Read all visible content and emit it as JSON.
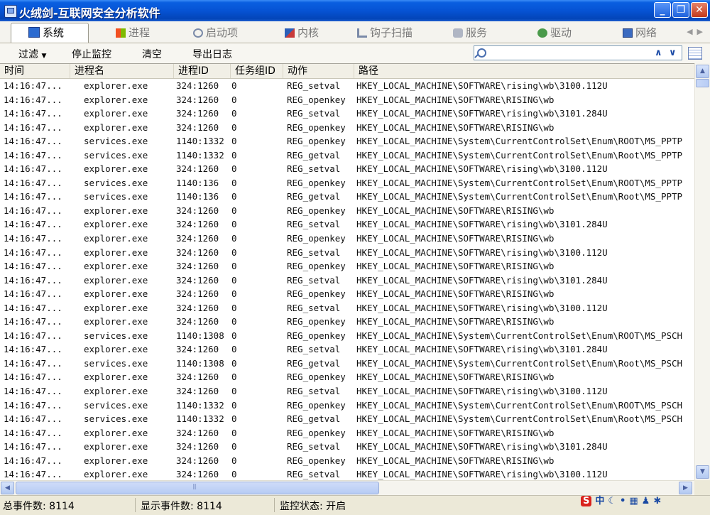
{
  "window": {
    "title": "火绒剑-互联网安全分析软件"
  },
  "tabs": [
    {
      "label": "系统",
      "icon": "system-icon",
      "active": true
    },
    {
      "label": "进程",
      "icon": "windows-flag-icon",
      "active": false
    },
    {
      "label": "启动项",
      "icon": "gear-icon",
      "active": false
    },
    {
      "label": "内核",
      "icon": "kernel-icon",
      "active": false
    },
    {
      "label": "钩子扫描",
      "icon": "hook-icon",
      "active": false
    },
    {
      "label": "服务",
      "icon": "service-icon",
      "active": false
    },
    {
      "label": "驱动",
      "icon": "driver-icon",
      "active": false
    },
    {
      "label": "网络",
      "icon": "network-icon",
      "active": false
    }
  ],
  "toolbar": {
    "filter": "过滤",
    "stop": "停止监控",
    "clear": "清空",
    "export": "导出日志",
    "search_value": ""
  },
  "columns": [
    "时间",
    "进程名",
    "进程ID",
    "任务组ID",
    "动作",
    "路径"
  ],
  "rows": [
    {
      "time": "14:16:47...",
      "icon": "explorer-icon",
      "name": "explorer.exe",
      "pid": "324:1260",
      "tg": "0",
      "action": "REG_setval",
      "path": "HKEY_LOCAL_MACHINE\\SOFTWARE\\rising\\wb\\3100.112U"
    },
    {
      "time": "14:16:47...",
      "icon": "explorer-icon",
      "name": "explorer.exe",
      "pid": "324:1260",
      "tg": "0",
      "action": "REG_openkey",
      "path": "HKEY_LOCAL_MACHINE\\SOFTWARE\\RISING\\wb"
    },
    {
      "time": "14:16:47...",
      "icon": "explorer-icon",
      "name": "explorer.exe",
      "pid": "324:1260",
      "tg": "0",
      "action": "REG_setval",
      "path": "HKEY_LOCAL_MACHINE\\SOFTWARE\\rising\\wb\\3101.284U"
    },
    {
      "time": "14:16:47...",
      "icon": "explorer-icon",
      "name": "explorer.exe",
      "pid": "324:1260",
      "tg": "0",
      "action": "REG_openkey",
      "path": "HKEY_LOCAL_MACHINE\\SOFTWARE\\RISING\\wb"
    },
    {
      "time": "14:16:47...",
      "icon": "services-icon",
      "name": "services.exe",
      "pid": "1140:1332",
      "tg": "0",
      "action": "REG_openkey",
      "path": "HKEY_LOCAL_MACHINE\\System\\CurrentControlSet\\Enum\\ROOT\\MS_PPTP"
    },
    {
      "time": "14:16:47...",
      "icon": "services-icon",
      "name": "services.exe",
      "pid": "1140:1332",
      "tg": "0",
      "action": "REG_getval",
      "path": "HKEY_LOCAL_MACHINE\\System\\CurrentControlSet\\Enum\\Root\\MS_PPTP"
    },
    {
      "time": "14:16:47...",
      "icon": "explorer-icon",
      "name": "explorer.exe",
      "pid": "324:1260",
      "tg": "0",
      "action": "REG_setval",
      "path": "HKEY_LOCAL_MACHINE\\SOFTWARE\\rising\\wb\\3100.112U"
    },
    {
      "time": "14:16:47...",
      "icon": "services-icon",
      "name": "services.exe",
      "pid": "1140:136",
      "tg": "0",
      "action": "REG_openkey",
      "path": "HKEY_LOCAL_MACHINE\\System\\CurrentControlSet\\Enum\\ROOT\\MS_PPTP"
    },
    {
      "time": "14:16:47...",
      "icon": "services-icon",
      "name": "services.exe",
      "pid": "1140:136",
      "tg": "0",
      "action": "REG_getval",
      "path": "HKEY_LOCAL_MACHINE\\System\\CurrentControlSet\\Enum\\Root\\MS_PPTP"
    },
    {
      "time": "14:16:47...",
      "icon": "explorer-icon",
      "name": "explorer.exe",
      "pid": "324:1260",
      "tg": "0",
      "action": "REG_openkey",
      "path": "HKEY_LOCAL_MACHINE\\SOFTWARE\\RISING\\wb"
    },
    {
      "time": "14:16:47...",
      "icon": "explorer-icon",
      "name": "explorer.exe",
      "pid": "324:1260",
      "tg": "0",
      "action": "REG_setval",
      "path": "HKEY_LOCAL_MACHINE\\SOFTWARE\\rising\\wb\\3101.284U"
    },
    {
      "time": "14:16:47...",
      "icon": "explorer-icon",
      "name": "explorer.exe",
      "pid": "324:1260",
      "tg": "0",
      "action": "REG_openkey",
      "path": "HKEY_LOCAL_MACHINE\\SOFTWARE\\RISING\\wb"
    },
    {
      "time": "14:16:47...",
      "icon": "explorer-icon",
      "name": "explorer.exe",
      "pid": "324:1260",
      "tg": "0",
      "action": "REG_setval",
      "path": "HKEY_LOCAL_MACHINE\\SOFTWARE\\rising\\wb\\3100.112U"
    },
    {
      "time": "14:16:47...",
      "icon": "explorer-icon",
      "name": "explorer.exe",
      "pid": "324:1260",
      "tg": "0",
      "action": "REG_openkey",
      "path": "HKEY_LOCAL_MACHINE\\SOFTWARE\\RISING\\wb"
    },
    {
      "time": "14:16:47...",
      "icon": "explorer-icon",
      "name": "explorer.exe",
      "pid": "324:1260",
      "tg": "0",
      "action": "REG_setval",
      "path": "HKEY_LOCAL_MACHINE\\SOFTWARE\\rising\\wb\\3101.284U"
    },
    {
      "time": "14:16:47...",
      "icon": "explorer-icon",
      "name": "explorer.exe",
      "pid": "324:1260",
      "tg": "0",
      "action": "REG_openkey",
      "path": "HKEY_LOCAL_MACHINE\\SOFTWARE\\RISING\\wb"
    },
    {
      "time": "14:16:47...",
      "icon": "explorer-icon",
      "name": "explorer.exe",
      "pid": "324:1260",
      "tg": "0",
      "action": "REG_setval",
      "path": "HKEY_LOCAL_MACHINE\\SOFTWARE\\rising\\wb\\3100.112U"
    },
    {
      "time": "14:16:47...",
      "icon": "explorer-icon",
      "name": "explorer.exe",
      "pid": "324:1260",
      "tg": "0",
      "action": "REG_openkey",
      "path": "HKEY_LOCAL_MACHINE\\SOFTWARE\\RISING\\wb"
    },
    {
      "time": "14:16:47...",
      "icon": "services-icon",
      "name": "services.exe",
      "pid": "1140:1308",
      "tg": "0",
      "action": "REG_openkey",
      "path": "HKEY_LOCAL_MACHINE\\System\\CurrentControlSet\\Enum\\ROOT\\MS_PSCH"
    },
    {
      "time": "14:16:47...",
      "icon": "explorer-icon",
      "name": "explorer.exe",
      "pid": "324:1260",
      "tg": "0",
      "action": "REG_setval",
      "path": "HKEY_LOCAL_MACHINE\\SOFTWARE\\rising\\wb\\3101.284U"
    },
    {
      "time": "14:16:47...",
      "icon": "services-icon",
      "name": "services.exe",
      "pid": "1140:1308",
      "tg": "0",
      "action": "REG_getval",
      "path": "HKEY_LOCAL_MACHINE\\System\\CurrentControlSet\\Enum\\Root\\MS_PSCH"
    },
    {
      "time": "14:16:47...",
      "icon": "explorer-icon",
      "name": "explorer.exe",
      "pid": "324:1260",
      "tg": "0",
      "action": "REG_openkey",
      "path": "HKEY_LOCAL_MACHINE\\SOFTWARE\\RISING\\wb"
    },
    {
      "time": "14:16:47...",
      "icon": "explorer-icon",
      "name": "explorer.exe",
      "pid": "324:1260",
      "tg": "0",
      "action": "REG_setval",
      "path": "HKEY_LOCAL_MACHINE\\SOFTWARE\\rising\\wb\\3100.112U"
    },
    {
      "time": "14:16:47...",
      "icon": "services-icon",
      "name": "services.exe",
      "pid": "1140:1332",
      "tg": "0",
      "action": "REG_openkey",
      "path": "HKEY_LOCAL_MACHINE\\System\\CurrentControlSet\\Enum\\ROOT\\MS_PSCH"
    },
    {
      "time": "14:16:47...",
      "icon": "services-icon",
      "name": "services.exe",
      "pid": "1140:1332",
      "tg": "0",
      "action": "REG_getval",
      "path": "HKEY_LOCAL_MACHINE\\System\\CurrentControlSet\\Enum\\Root\\MS_PSCH"
    },
    {
      "time": "14:16:47...",
      "icon": "explorer-icon",
      "name": "explorer.exe",
      "pid": "324:1260",
      "tg": "0",
      "action": "REG_openkey",
      "path": "HKEY_LOCAL_MACHINE\\SOFTWARE\\RISING\\wb"
    },
    {
      "time": "14:16:47...",
      "icon": "explorer-icon",
      "name": "explorer.exe",
      "pid": "324:1260",
      "tg": "0",
      "action": "REG_setval",
      "path": "HKEY_LOCAL_MACHINE\\SOFTWARE\\rising\\wb\\3101.284U"
    },
    {
      "time": "14:16:47...",
      "icon": "explorer-icon",
      "name": "explorer.exe",
      "pid": "324:1260",
      "tg": "0",
      "action": "REG_openkey",
      "path": "HKEY_LOCAL_MACHINE\\SOFTWARE\\RISING\\wb"
    },
    {
      "time": "14:16:47...",
      "icon": "explorer-icon",
      "name": "explorer.exe",
      "pid": "324:1260",
      "tg": "0",
      "action": "REG_setval",
      "path": "HKEY_LOCAL_MACHINE\\SOFTWARE\\rising\\wb\\3100.112U"
    }
  ],
  "status": {
    "total": "总事件数: 8114",
    "shown": "显示事件数: 8114",
    "monitor": "监控状态: 开启"
  },
  "ime": {
    "logo": "S",
    "mode": "中"
  },
  "colors": {
    "titlebar": "#0653d4",
    "selected_tab": "#ffffff",
    "grid_bg": "#ffffff"
  }
}
